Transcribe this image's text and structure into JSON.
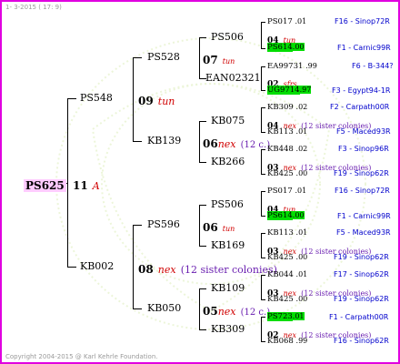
{
  "colors": {
    "frame": "#e000e0",
    "origin": "#0000cc",
    "subspecies": "#d00000",
    "sister": "#6a1fb0",
    "highlight": "#00dd00",
    "root_bg": "#ffccff"
  },
  "header": {
    "date": "1-  3-2015  ( 17:  9)"
  },
  "footer": {
    "copyright": "Copyright 2004-2015 @ Karl Kehrle Foundation."
  },
  "root": {
    "name": "PS625",
    "gen": "11",
    "sub": "A"
  },
  "g1": {
    "top": {
      "name": "PS548",
      "gen": "09",
      "sub": "tun"
    },
    "bottom": {
      "name": "KB002",
      "gen": "08",
      "sub": "nex",
      "note": "(12 sister colonies)"
    }
  },
  "g2": {
    "a": {
      "name": "PS528",
      "gen": "07",
      "sub": "tun"
    },
    "b": {
      "name": "KB139",
      "gen": "06",
      "sub": "nex",
      "note": "(12 c.)"
    },
    "c": {
      "name": "PS596",
      "gen": "06",
      "sub": "tun"
    },
    "d": {
      "name": "KB050",
      "gen": "05",
      "sub": "nex",
      "note": "(12 c.)"
    }
  },
  "g3": {
    "a1": "PS506",
    "a2": "EAN02321",
    "b1": "KB075",
    "b2": "KB266",
    "c1": "PS506",
    "c2": "KB169",
    "d1": "KB109",
    "d2": "KB309"
  },
  "g4": {
    "a1p": {
      "name": "PS017",
      "yr": ".01",
      "origin": "F16 - Sinop72R"
    },
    "a1m": {
      "name": "PS614",
      "yr": ".00",
      "origin": "F1 - Carnic99R"
    },
    "a1g": {
      "gen": "04",
      "sub": "tun"
    },
    "a2p": {
      "name": "EA99731",
      "yr": ".99",
      "origin": "F6 - B-344?"
    },
    "a2m": {
      "name": "UG9714",
      "yr": ".97",
      "origin": "F3 - Egypt94-1R"
    },
    "a2g": {
      "gen": "02",
      "sub": "sfrs"
    },
    "b1p": {
      "name": "KB309",
      "yr": ".02",
      "origin": "F2 - Carpath00R"
    },
    "b1m": {
      "name": "KB113",
      "yr": ".01",
      "origin": "F5 - Maced93R"
    },
    "b1g": {
      "gen": "04",
      "sub": "nex",
      "note": "(12 sister colonies)"
    },
    "b2p": {
      "name": "KB448",
      "yr": ".02",
      "origin": "F3 - Sinop96R"
    },
    "b2m": {
      "name": "KB425",
      "yr": ".00",
      "origin": "F19 - Sinop62R"
    },
    "b2g": {
      "gen": "03",
      "sub": "nex",
      "note": "(12 sister colonies)"
    },
    "c1p": {
      "name": "PS017",
      "yr": ".01",
      "origin": "F16 - Sinop72R"
    },
    "c1m": {
      "name": "PS614",
      "yr": ".00",
      "origin": "F1 - Carnic99R"
    },
    "c1g": {
      "gen": "04",
      "sub": "tun"
    },
    "c2p": {
      "name": "KB113",
      "yr": ".01",
      "origin": "F5 - Maced93R"
    },
    "c2m": {
      "name": "KB425",
      "yr": ".00",
      "origin": "F19 - Sinop62R"
    },
    "c2g": {
      "gen": "03",
      "sub": "nex",
      "note": "(12 sister colonies)"
    },
    "d1p": {
      "name": "KB044",
      "yr": ".01",
      "origin": "F17 - Sinop62R"
    },
    "d1m": {
      "name": "KB425",
      "yr": ".00",
      "origin": "F19 - Sinop62R"
    },
    "d1g": {
      "gen": "03",
      "sub": "nex",
      "note": "(12 sister colonies)"
    },
    "d2p": {
      "name": "PS723",
      "yr": ".01",
      "origin": "F1 - Carpath00R"
    },
    "d2m": {
      "name": "KB068",
      "yr": ".99",
      "origin": "F16 - Sinop62R"
    },
    "d2g": {
      "gen": "02",
      "sub": "nex",
      "note": "(12 sister colonies)"
    }
  }
}
